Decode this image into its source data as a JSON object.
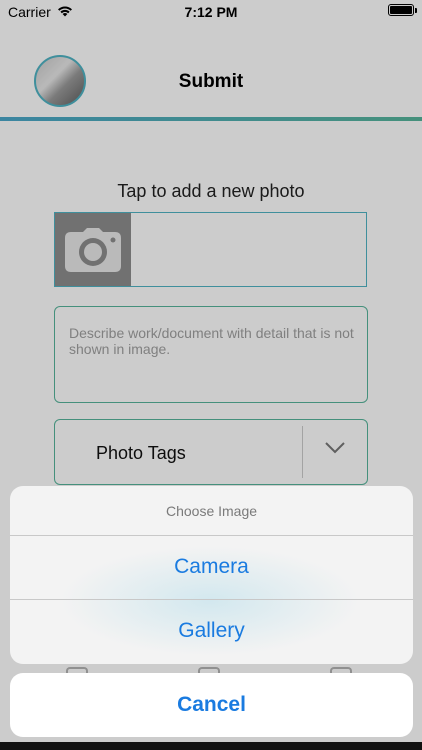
{
  "status_bar": {
    "carrier": "Carrier",
    "time": "7:12 PM"
  },
  "nav": {
    "title": "Submit"
  },
  "form": {
    "photo_hint": "Tap to add a new photo",
    "description_placeholder": "Describe work/document with detail that is not shown in image.",
    "tags_label": "Photo Tags"
  },
  "action_sheet": {
    "title": "Choose Image",
    "options": [
      "Camera",
      "Gallery"
    ],
    "cancel_label": "Cancel"
  },
  "colors": {
    "accent_blue": "#1a7be0",
    "border_teal": "#57b59b",
    "border_cyan": "#4fb3c4"
  },
  "icons": [
    "wifi-icon",
    "battery-icon",
    "camera-icon",
    "chevron-down-icon"
  ]
}
